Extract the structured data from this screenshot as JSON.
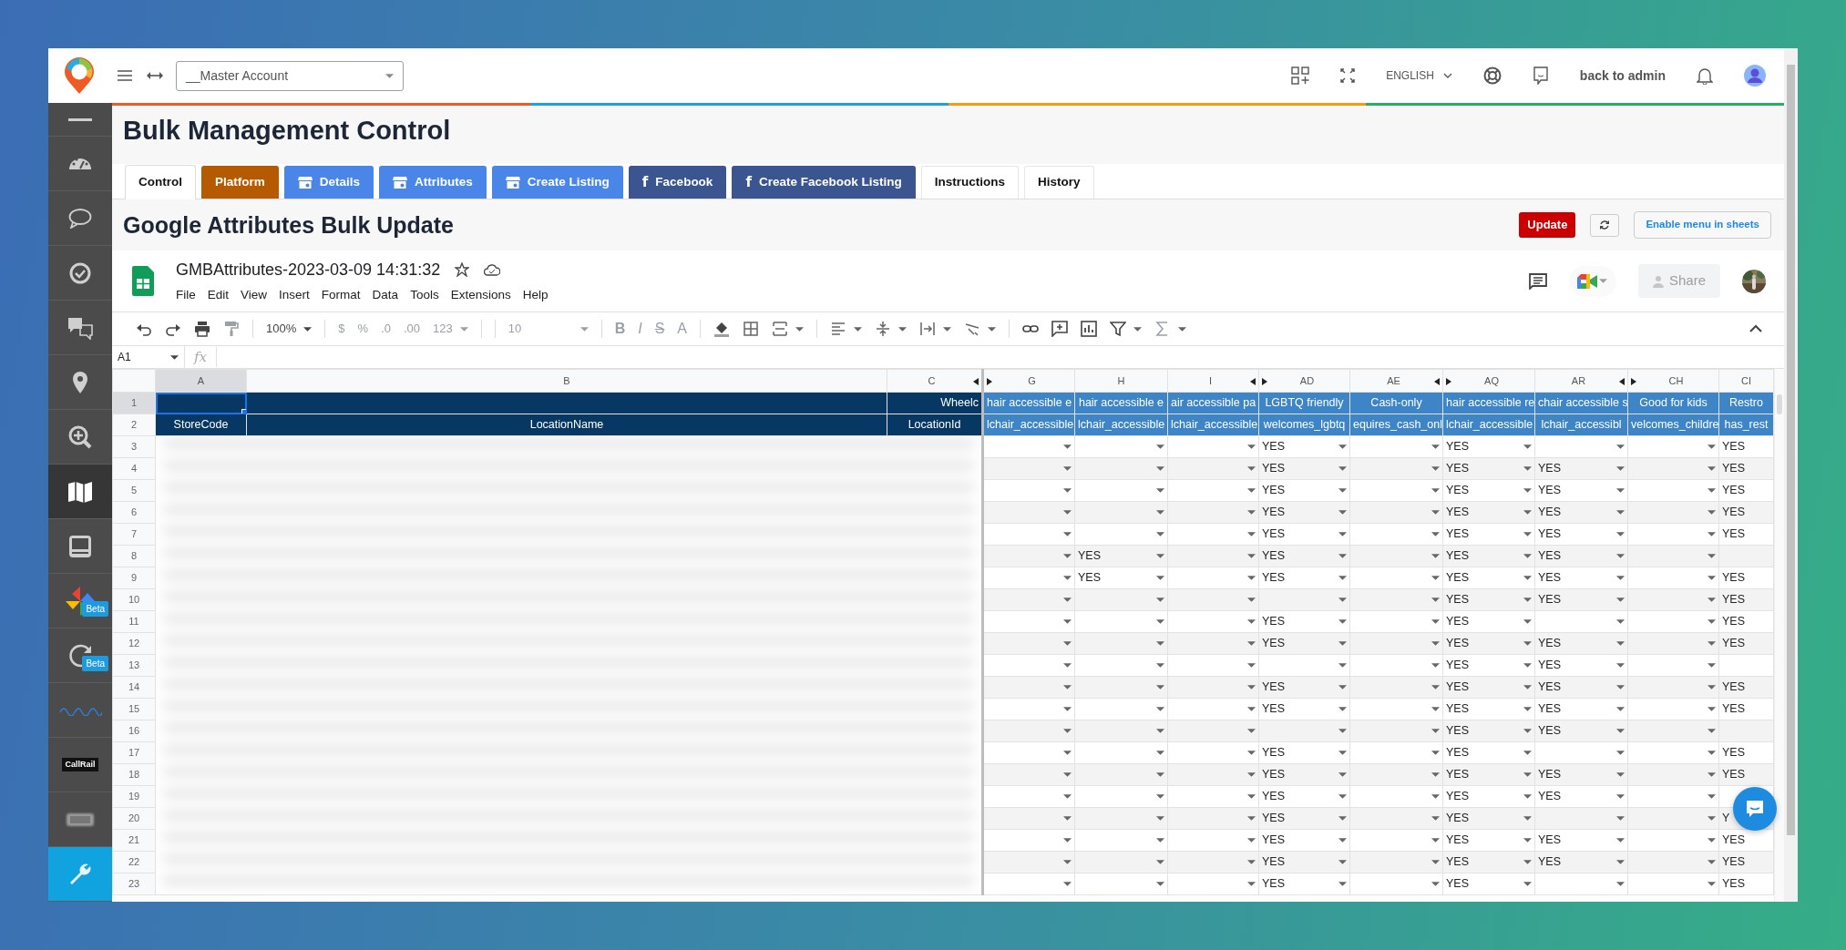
{
  "topbar": {
    "account_select": "__Master Account",
    "language": "ENGLISH",
    "back_link": "back to admin"
  },
  "sidebar": {
    "items": [
      {
        "selected": false
      },
      {
        "selected": false
      },
      {
        "selected": false
      },
      {
        "selected": false
      },
      {
        "selected": false
      },
      {
        "selected": false
      },
      {
        "selected": false
      },
      {
        "selected": true
      },
      {
        "selected": false
      },
      {
        "selected": false,
        "badge": "Beta"
      },
      {
        "selected": false,
        "badge": "Beta"
      },
      {
        "selected": false
      },
      {
        "selected": false,
        "label": "CallRail"
      },
      {
        "selected": false
      },
      {
        "selected": false,
        "accent": true
      }
    ]
  },
  "page_title": "Bulk Management Control",
  "tabs": [
    {
      "label": "Control",
      "kind": "plain",
      "selected": true
    },
    {
      "label": "Platform",
      "kind": "platform",
      "selected": false
    },
    {
      "label": "Details",
      "kind": "google",
      "selected": false
    },
    {
      "label": "Attributes",
      "kind": "google",
      "selected": false
    },
    {
      "label": "Create Listing",
      "kind": "google",
      "selected": false
    },
    {
      "label": "Facebook",
      "kind": "facebook",
      "icon_char": "f",
      "selected": false
    },
    {
      "label": "Create Facebook Listing",
      "kind": "facebook",
      "icon_char": "f",
      "selected": false
    },
    {
      "label": "Instructions",
      "kind": "plain",
      "selected": false
    },
    {
      "label": "History",
      "kind": "plain",
      "selected": false
    }
  ],
  "section_title": "Google Attributes Bulk Update",
  "actions": {
    "update": "Update",
    "enable_menu": "Enable menu in sheets"
  },
  "sheet": {
    "title": "GMBAttributes-2023-03-09 14:31:32",
    "menu": [
      "File",
      "Edit",
      "View",
      "Insert",
      "Format",
      "Data",
      "Tools",
      "Extensions",
      "Help"
    ],
    "share": "Share",
    "toolbar": {
      "zoom": "100%",
      "number_formats": [
        {
          "label": "$",
          "disabled": true
        },
        {
          "label": "%",
          "disabled": true
        },
        {
          "label": ".0",
          "disabled": true
        },
        {
          "label": ".00",
          "disabled": true
        },
        {
          "label": "123",
          "disabled": true
        }
      ],
      "font_size": {
        "label": "10",
        "disabled": true
      },
      "text_styles": [
        {
          "label": "B",
          "disabled": true
        },
        {
          "label": "I",
          "disabled": true
        },
        {
          "label": "S",
          "disabled": true
        },
        {
          "label": "A",
          "disabled": true
        }
      ]
    },
    "name_box": "A1",
    "fx": "fx",
    "columns": [
      {
        "letter": "A",
        "selected": true,
        "field": "StoreCode"
      },
      {
        "letter": "B",
        "selected": false,
        "field": "LocationName"
      },
      {
        "letter": "C",
        "selected": false,
        "hidden_after": true,
        "title": "Wheelc",
        "field": "LocationId"
      },
      {
        "letter": "G",
        "selected": false,
        "hidden_before": true,
        "title": "hair accessible e",
        "field": "lchair_accessible"
      },
      {
        "letter": "H",
        "selected": false,
        "title": "hair accessible e",
        "field": "lchair_accessible"
      },
      {
        "letter": "I",
        "selected": false,
        "hidden_after": true,
        "title": "air accessible pa",
        "field": "lchair_accessible"
      },
      {
        "letter": "AD",
        "selected": false,
        "hidden_before": true,
        "title": "LGBTQ friendly",
        "field": "welcomes_lgbtq"
      },
      {
        "letter": "AE",
        "selected": false,
        "hidden_after": true,
        "title": "Cash-only",
        "field": "equires_cash_onl"
      },
      {
        "letter": "AQ",
        "selected": false,
        "hidden_before": true,
        "title": "hair accessible re",
        "field": "lchair_accessible"
      },
      {
        "letter": "AR",
        "selected": false,
        "hidden_after": true,
        "title": "chair accessible s",
        "field": "lchair_accessibl"
      },
      {
        "letter": "CH",
        "selected": false,
        "hidden_before": true,
        "title": "Good for kids",
        "field": "velcomes_childre"
      },
      {
        "letter": "CI",
        "selected": false,
        "title": "Restro",
        "field": "has_rest"
      }
    ],
    "header_rows": [
      {
        "number": "1",
        "selected": true
      },
      {
        "number": "2",
        "selected": false
      }
    ],
    "rows": [
      {
        "number": "3",
        "cells": [
          {
            "kind": "blurred"
          },
          {
            "kind": "blurred"
          },
          {
            "kind": "blurred"
          },
          {
            "kind": "dropdown"
          },
          {
            "kind": "dropdown"
          },
          {
            "kind": "dropdown"
          },
          {
            "kind": "dropdown",
            "value": "YES"
          },
          {
            "kind": "dropdown"
          },
          {
            "kind": "dropdown",
            "value": "YES"
          },
          {
            "kind": "dropdown"
          },
          {
            "kind": "dropdown"
          },
          {
            "kind": "plain",
            "value": "YES"
          }
        ]
      },
      {
        "number": "4",
        "cells": [
          {
            "kind": "blurred"
          },
          {
            "kind": "blurred"
          },
          {
            "kind": "blurred"
          },
          {
            "kind": "dropdown"
          },
          {
            "kind": "dropdown"
          },
          {
            "kind": "dropdown"
          },
          {
            "kind": "dropdown",
            "value": "YES"
          },
          {
            "kind": "dropdown"
          },
          {
            "kind": "dropdown",
            "value": "YES"
          },
          {
            "kind": "dropdown",
            "value": "YES"
          },
          {
            "kind": "dropdown"
          },
          {
            "kind": "plain",
            "value": "YES"
          }
        ]
      },
      {
        "number": "5",
        "cells": [
          {
            "kind": "blurred"
          },
          {
            "kind": "blurred"
          },
          {
            "kind": "blurred"
          },
          {
            "kind": "dropdown"
          },
          {
            "kind": "dropdown"
          },
          {
            "kind": "dropdown"
          },
          {
            "kind": "dropdown",
            "value": "YES"
          },
          {
            "kind": "dropdown"
          },
          {
            "kind": "dropdown",
            "value": "YES"
          },
          {
            "kind": "dropdown",
            "value": "YES"
          },
          {
            "kind": "dropdown"
          },
          {
            "kind": "plain",
            "value": "YES"
          }
        ]
      },
      {
        "number": "6",
        "cells": [
          {
            "kind": "blurred"
          },
          {
            "kind": "blurred"
          },
          {
            "kind": "blurred"
          },
          {
            "kind": "dropdown"
          },
          {
            "kind": "dropdown"
          },
          {
            "kind": "dropdown"
          },
          {
            "kind": "dropdown",
            "value": "YES"
          },
          {
            "kind": "dropdown"
          },
          {
            "kind": "dropdown",
            "value": "YES"
          },
          {
            "kind": "dropdown",
            "value": "YES"
          },
          {
            "kind": "dropdown"
          },
          {
            "kind": "plain",
            "value": "YES"
          }
        ]
      },
      {
        "number": "7",
        "cells": [
          {
            "kind": "blurred"
          },
          {
            "kind": "blurred"
          },
          {
            "kind": "blurred"
          },
          {
            "kind": "dropdown"
          },
          {
            "kind": "dropdown"
          },
          {
            "kind": "dropdown"
          },
          {
            "kind": "dropdown",
            "value": "YES"
          },
          {
            "kind": "dropdown"
          },
          {
            "kind": "dropdown",
            "value": "YES"
          },
          {
            "kind": "dropdown",
            "value": "YES"
          },
          {
            "kind": "dropdown"
          },
          {
            "kind": "plain",
            "value": "YES"
          }
        ]
      },
      {
        "number": "8",
        "cells": [
          {
            "kind": "blurred"
          },
          {
            "kind": "blurred"
          },
          {
            "kind": "blurred"
          },
          {
            "kind": "dropdown"
          },
          {
            "kind": "dropdown",
            "value": "YES"
          },
          {
            "kind": "dropdown"
          },
          {
            "kind": "dropdown",
            "value": "YES"
          },
          {
            "kind": "dropdown"
          },
          {
            "kind": "dropdown",
            "value": "YES"
          },
          {
            "kind": "dropdown",
            "value": "YES"
          },
          {
            "kind": "dropdown"
          },
          {
            "kind": "plain"
          }
        ]
      },
      {
        "number": "9",
        "cells": [
          {
            "kind": "blurred"
          },
          {
            "kind": "blurred"
          },
          {
            "kind": "blurred"
          },
          {
            "kind": "dropdown"
          },
          {
            "kind": "dropdown",
            "value": "YES"
          },
          {
            "kind": "dropdown"
          },
          {
            "kind": "dropdown",
            "value": "YES"
          },
          {
            "kind": "dropdown"
          },
          {
            "kind": "dropdown",
            "value": "YES"
          },
          {
            "kind": "dropdown",
            "value": "YES"
          },
          {
            "kind": "dropdown"
          },
          {
            "kind": "plain",
            "value": "YES"
          }
        ]
      },
      {
        "number": "10",
        "cells": [
          {
            "kind": "blurred"
          },
          {
            "kind": "blurred"
          },
          {
            "kind": "blurred"
          },
          {
            "kind": "dropdown"
          },
          {
            "kind": "dropdown"
          },
          {
            "kind": "dropdown"
          },
          {
            "kind": "dropdown"
          },
          {
            "kind": "dropdown"
          },
          {
            "kind": "dropdown",
            "value": "YES"
          },
          {
            "kind": "dropdown",
            "value": "YES"
          },
          {
            "kind": "dropdown"
          },
          {
            "kind": "plain",
            "value": "YES"
          }
        ]
      },
      {
        "number": "11",
        "cells": [
          {
            "kind": "blurred"
          },
          {
            "kind": "blurred"
          },
          {
            "kind": "blurred"
          },
          {
            "kind": "dropdown"
          },
          {
            "kind": "dropdown"
          },
          {
            "kind": "dropdown"
          },
          {
            "kind": "dropdown",
            "value": "YES"
          },
          {
            "kind": "dropdown"
          },
          {
            "kind": "dropdown",
            "value": "YES"
          },
          {
            "kind": "dropdown"
          },
          {
            "kind": "dropdown"
          },
          {
            "kind": "plain",
            "value": "YES"
          }
        ]
      },
      {
        "number": "12",
        "cells": [
          {
            "kind": "blurred"
          },
          {
            "kind": "blurred"
          },
          {
            "kind": "blurred"
          },
          {
            "kind": "dropdown"
          },
          {
            "kind": "dropdown"
          },
          {
            "kind": "dropdown"
          },
          {
            "kind": "dropdown",
            "value": "YES"
          },
          {
            "kind": "dropdown"
          },
          {
            "kind": "dropdown",
            "value": "YES"
          },
          {
            "kind": "dropdown",
            "value": "YES"
          },
          {
            "kind": "dropdown"
          },
          {
            "kind": "plain",
            "value": "YES"
          }
        ]
      },
      {
        "number": "13",
        "cells": [
          {
            "kind": "blurred"
          },
          {
            "kind": "blurred"
          },
          {
            "kind": "blurred"
          },
          {
            "kind": "dropdown"
          },
          {
            "kind": "dropdown"
          },
          {
            "kind": "dropdown"
          },
          {
            "kind": "dropdown"
          },
          {
            "kind": "dropdown"
          },
          {
            "kind": "dropdown",
            "value": "YES"
          },
          {
            "kind": "dropdown",
            "value": "YES"
          },
          {
            "kind": "dropdown"
          },
          {
            "kind": "plain"
          }
        ]
      },
      {
        "number": "14",
        "cells": [
          {
            "kind": "blurred"
          },
          {
            "kind": "blurred"
          },
          {
            "kind": "blurred"
          },
          {
            "kind": "dropdown"
          },
          {
            "kind": "dropdown"
          },
          {
            "kind": "dropdown"
          },
          {
            "kind": "dropdown",
            "value": "YES"
          },
          {
            "kind": "dropdown"
          },
          {
            "kind": "dropdown",
            "value": "YES"
          },
          {
            "kind": "dropdown",
            "value": "YES"
          },
          {
            "kind": "dropdown"
          },
          {
            "kind": "plain",
            "value": "YES"
          }
        ]
      },
      {
        "number": "15",
        "cells": [
          {
            "kind": "blurred"
          },
          {
            "kind": "blurred"
          },
          {
            "kind": "blurred"
          },
          {
            "kind": "dropdown"
          },
          {
            "kind": "dropdown"
          },
          {
            "kind": "dropdown"
          },
          {
            "kind": "dropdown",
            "value": "YES"
          },
          {
            "kind": "dropdown"
          },
          {
            "kind": "dropdown",
            "value": "YES"
          },
          {
            "kind": "dropdown",
            "value": "YES"
          },
          {
            "kind": "dropdown"
          },
          {
            "kind": "plain",
            "value": "YES"
          }
        ]
      },
      {
        "number": "16",
        "cells": [
          {
            "kind": "blurred"
          },
          {
            "kind": "blurred"
          },
          {
            "kind": "blurred"
          },
          {
            "kind": "dropdown"
          },
          {
            "kind": "dropdown"
          },
          {
            "kind": "dropdown"
          },
          {
            "kind": "dropdown"
          },
          {
            "kind": "dropdown"
          },
          {
            "kind": "dropdown",
            "value": "YES"
          },
          {
            "kind": "dropdown",
            "value": "YES"
          },
          {
            "kind": "dropdown"
          },
          {
            "kind": "plain"
          }
        ]
      },
      {
        "number": "17",
        "cells": [
          {
            "kind": "blurred"
          },
          {
            "kind": "blurred"
          },
          {
            "kind": "blurred"
          },
          {
            "kind": "dropdown"
          },
          {
            "kind": "dropdown"
          },
          {
            "kind": "dropdown"
          },
          {
            "kind": "dropdown",
            "value": "YES"
          },
          {
            "kind": "dropdown"
          },
          {
            "kind": "dropdown",
            "value": "YES"
          },
          {
            "kind": "dropdown"
          },
          {
            "kind": "dropdown"
          },
          {
            "kind": "plain",
            "value": "YES"
          }
        ]
      },
      {
        "number": "18",
        "cells": [
          {
            "kind": "blurred"
          },
          {
            "kind": "blurred"
          },
          {
            "kind": "blurred"
          },
          {
            "kind": "dropdown"
          },
          {
            "kind": "dropdown"
          },
          {
            "kind": "dropdown"
          },
          {
            "kind": "dropdown",
            "value": "YES"
          },
          {
            "kind": "dropdown"
          },
          {
            "kind": "dropdown",
            "value": "YES"
          },
          {
            "kind": "dropdown",
            "value": "YES"
          },
          {
            "kind": "dropdown"
          },
          {
            "kind": "plain",
            "value": "YES"
          }
        ]
      },
      {
        "number": "19",
        "cells": [
          {
            "kind": "blurred"
          },
          {
            "kind": "blurred"
          },
          {
            "kind": "blurred"
          },
          {
            "kind": "dropdown"
          },
          {
            "kind": "dropdown"
          },
          {
            "kind": "dropdown"
          },
          {
            "kind": "dropdown",
            "value": "YES"
          },
          {
            "kind": "dropdown"
          },
          {
            "kind": "dropdown",
            "value": "YES"
          },
          {
            "kind": "dropdown",
            "value": "YES"
          },
          {
            "kind": "dropdown"
          },
          {
            "kind": "plain"
          }
        ]
      },
      {
        "number": "20",
        "cells": [
          {
            "kind": "blurred"
          },
          {
            "kind": "blurred"
          },
          {
            "kind": "blurred"
          },
          {
            "kind": "dropdown"
          },
          {
            "kind": "dropdown"
          },
          {
            "kind": "dropdown"
          },
          {
            "kind": "dropdown",
            "value": "YES"
          },
          {
            "kind": "dropdown"
          },
          {
            "kind": "dropdown",
            "value": "YES"
          },
          {
            "kind": "dropdown"
          },
          {
            "kind": "dropdown"
          },
          {
            "kind": "plain",
            "value": "Y"
          }
        ]
      },
      {
        "number": "21",
        "cells": [
          {
            "kind": "blurred"
          },
          {
            "kind": "blurred"
          },
          {
            "kind": "blurred"
          },
          {
            "kind": "dropdown"
          },
          {
            "kind": "dropdown"
          },
          {
            "kind": "dropdown"
          },
          {
            "kind": "dropdown",
            "value": "YES"
          },
          {
            "kind": "dropdown"
          },
          {
            "kind": "dropdown",
            "value": "YES"
          },
          {
            "kind": "dropdown",
            "value": "YES"
          },
          {
            "kind": "dropdown"
          },
          {
            "kind": "plain",
            "value": "YES"
          }
        ]
      },
      {
        "number": "22",
        "cells": [
          {
            "kind": "blurred"
          },
          {
            "kind": "blurred"
          },
          {
            "kind": "blurred"
          },
          {
            "kind": "dropdown"
          },
          {
            "kind": "dropdown"
          },
          {
            "kind": "dropdown"
          },
          {
            "kind": "dropdown",
            "value": "YES"
          },
          {
            "kind": "dropdown"
          },
          {
            "kind": "dropdown",
            "value": "YES"
          },
          {
            "kind": "dropdown",
            "value": "YES"
          },
          {
            "kind": "dropdown"
          },
          {
            "kind": "plain",
            "value": "YES"
          }
        ]
      },
      {
        "number": "23",
        "cells": [
          {
            "kind": "blurred"
          },
          {
            "kind": "blurred"
          },
          {
            "kind": "blurred"
          },
          {
            "kind": "dropdown"
          },
          {
            "kind": "dropdown"
          },
          {
            "kind": "dropdown"
          },
          {
            "kind": "dropdown",
            "value": "YES"
          },
          {
            "kind": "dropdown"
          },
          {
            "kind": "dropdown",
            "value": "YES"
          },
          {
            "kind": "dropdown"
          },
          {
            "kind": "dropdown"
          },
          {
            "kind": "plain",
            "value": "YES"
          }
        ]
      }
    ]
  }
}
